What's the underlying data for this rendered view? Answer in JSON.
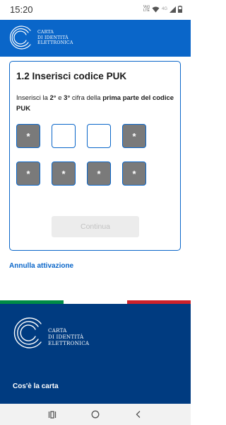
{
  "status_bar": {
    "time": "15:20",
    "volte_top": "Vo))",
    "volte_bottom": "LTE",
    "network": "4G"
  },
  "header": {
    "brand_lines": [
      "CARTA",
      "DI IDENTITÀ",
      "ELETTRONICA"
    ]
  },
  "card": {
    "title": "1.2 Inserisci codice PUK",
    "instruction": {
      "p1": "Inserisci la ",
      "b1": "2°",
      "p2": " e ",
      "b2": "3°",
      "p3": " cifra della ",
      "b3": "prima parte del codice PUK"
    },
    "digits_row1": [
      "*",
      "",
      "",
      "*"
    ],
    "digits_row2": [
      "*",
      "*",
      "*",
      "*"
    ],
    "continue_label": "Continua"
  },
  "cancel_link": "Annulla attivazione",
  "footer": {
    "brand_lines": [
      "CARTA",
      "DI IDENTITÀ",
      "ELETTRONICA"
    ],
    "link": "Cos'è la carta"
  },
  "colors": {
    "primary": "#0a66c9",
    "footer_bg": "#003b80",
    "filled_digit": "#7a7a7a",
    "flag_green": "#008c45",
    "flag_red": "#cd212a"
  },
  "icons": {
    "header_logo": "cie-logo-icon",
    "nav_recents": "recents-icon",
    "nav_home": "home-icon",
    "nav_back": "back-icon"
  }
}
